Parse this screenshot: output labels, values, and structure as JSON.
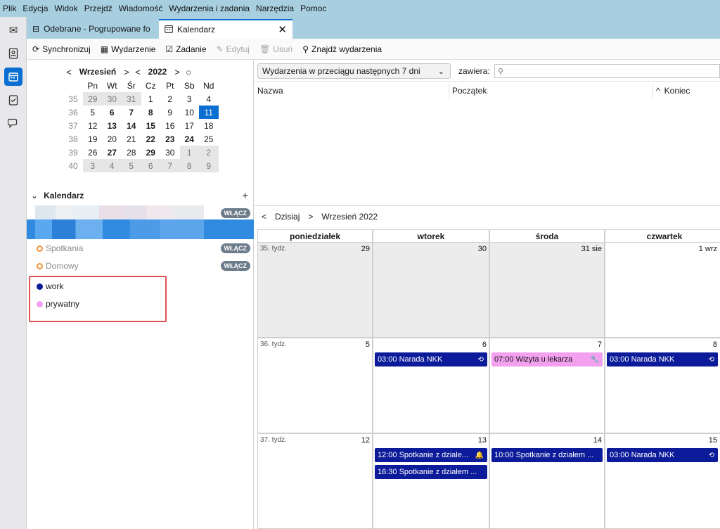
{
  "menubar": [
    "Plik",
    "Edycja",
    "Widok",
    "Przejdź",
    "Wiadomość",
    "Wydarzenia i zadania",
    "Narzędzia",
    "Pomoc"
  ],
  "spaces": [
    "mail-icon",
    "address-book-icon",
    "calendar-icon",
    "tasks-icon",
    "chat-icon"
  ],
  "tabs": {
    "inbox": "Odebrane - Pogrupowane fo",
    "calendar": "Kalendarz"
  },
  "toolbar": {
    "sync": "Synchronizuj",
    "event": "Wydarzenie",
    "task": "Zadanie",
    "edit": "Edytuj",
    "delete": "Usuń",
    "find": "Znajdź wydarzenia"
  },
  "minimonth": {
    "month": "Wrzesień",
    "year": "2022",
    "weekdays": [
      "Pn",
      "Wt",
      "Śr",
      "Cz",
      "Pt",
      "Sb",
      "Nd"
    ],
    "weeks": [
      {
        "wk": "35",
        "days": [
          "29",
          "30",
          "31",
          "1",
          "2",
          "3",
          "4"
        ]
      },
      {
        "wk": "36",
        "days": [
          "5",
          "6",
          "7",
          "8",
          "9",
          "10",
          "11"
        ]
      },
      {
        "wk": "37",
        "days": [
          "12",
          "13",
          "14",
          "15",
          "16",
          "17",
          "18"
        ]
      },
      {
        "wk": "38",
        "days": [
          "19",
          "20",
          "21",
          "22",
          "23",
          "24",
          "25"
        ]
      },
      {
        "wk": "39",
        "days": [
          "26",
          "27",
          "28",
          "29",
          "30",
          "1",
          "2"
        ]
      },
      {
        "wk": "40",
        "days": [
          "3",
          "4",
          "5",
          "6",
          "7",
          "8",
          "9"
        ]
      }
    ]
  },
  "calendars": {
    "title": "Kalendarz",
    "enable": "WŁĄCZ",
    "items": [
      {
        "name": "Spotkania"
      },
      {
        "name": "Domowy"
      },
      {
        "name": "work",
        "color": "#0c1b99"
      },
      {
        "name": "prywatny",
        "color": "#f3a0ef"
      }
    ]
  },
  "unifinder": {
    "filter": "Wydarzenia w przeciągu następnych 7 dni",
    "contains": "zawiera:",
    "columns": [
      "Nazwa",
      "Początek",
      "Koniec"
    ]
  },
  "nav": {
    "today": "Dzisiaj",
    "month": "Wrzesień 2022"
  },
  "monthview": {
    "days": [
      "poniedziałek",
      "wtorek",
      "środa",
      "czwartek"
    ],
    "weeks": [
      {
        "label": "35. tydz.",
        "dates": [
          "29",
          "30",
          "31 sie",
          "1 wrz"
        ]
      },
      {
        "label": "36. tydz.",
        "dates": [
          "5",
          "6",
          "7",
          "8"
        ]
      },
      {
        "label": "37. tydz.",
        "dates": [
          "12",
          "13",
          "14",
          "15"
        ]
      }
    ],
    "events": {
      "w36_tue": "03:00 Narada NKK",
      "w36_wed": "07:00 Wizyta u lekarza",
      "w36_thu": "03:00 Narada NKK",
      "w37_tue_1": "12:00 Spotkanie z dziale...",
      "w37_tue_2": "16:30 Spotkanie z działem ...",
      "w37_wed": "10:00 Spotkanie z działem ...",
      "w37_thu": "03:00 Narada NKK"
    }
  },
  "colors": {
    "accent": "#0b6fd1",
    "event_work": "#0c1b99",
    "event_private": "#f3a0ef",
    "menubar": "#a7cfe0"
  }
}
